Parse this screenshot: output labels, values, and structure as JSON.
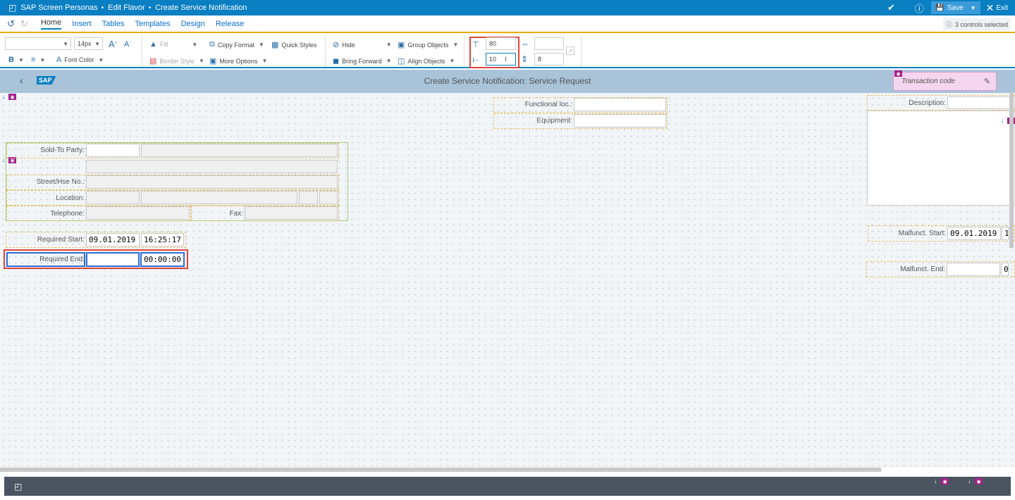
{
  "app": {
    "brand": "SAP Screen Personas",
    "crumb_edit": "Edit Flavor",
    "crumb_screen": "Create Service Notification",
    "save_label": "Save",
    "exit_label": "Exit"
  },
  "tabs": [
    "Home",
    "Insert",
    "Tables",
    "Templates",
    "Design",
    "Release"
  ],
  "selection_status": "3 controls selected",
  "toolbar": {
    "font_size": "14px",
    "font_color": "Font Color",
    "fill": "Fill",
    "border_style": "Border Style",
    "copy_format": "Copy Format",
    "more_options": "More Options",
    "quick_styles": "Quick Styles",
    "hide": "Hide",
    "bring_forward": "Bring Forward",
    "group_objects": "Group Objects",
    "align_objects": "Align Objects",
    "top_value": "80",
    "left_value": "10",
    "width_value": "",
    "height_value": "8"
  },
  "screen": {
    "sap_logo": "SAP",
    "title": "Create Service Notification: Service Request",
    "transaction_placeholder": "Transaction code",
    "functional_loc_label": "Functional loc.:",
    "equipment_label": "Equipment:",
    "description_label": "Description:",
    "sold_to_label": "Sold-To Party:",
    "street_label": "Street/Hse No.:",
    "location_label": "Location:",
    "telephone_label": "Telephone:",
    "fax_label": "Fax:",
    "req_start_label": "Required Start:",
    "req_start_date": "09.01.2019",
    "req_start_time": "16:25:17",
    "req_end_label": "Required End:",
    "req_end_date": "",
    "req_end_time": "00:00:00",
    "malf_start_label": "Malfunct. Start:",
    "malf_start_date": "09.01.2019",
    "malf_start_time": "1",
    "malf_end_label": "Malfunct. End:",
    "malf_end_date": "",
    "malf_end_time": "0"
  },
  "colors": {
    "shell_blue": "#0a7fc2",
    "accent_orange": "#f0ab00",
    "highlight_red": "#e0463a",
    "marker_magenta": "#a61e8e"
  }
}
